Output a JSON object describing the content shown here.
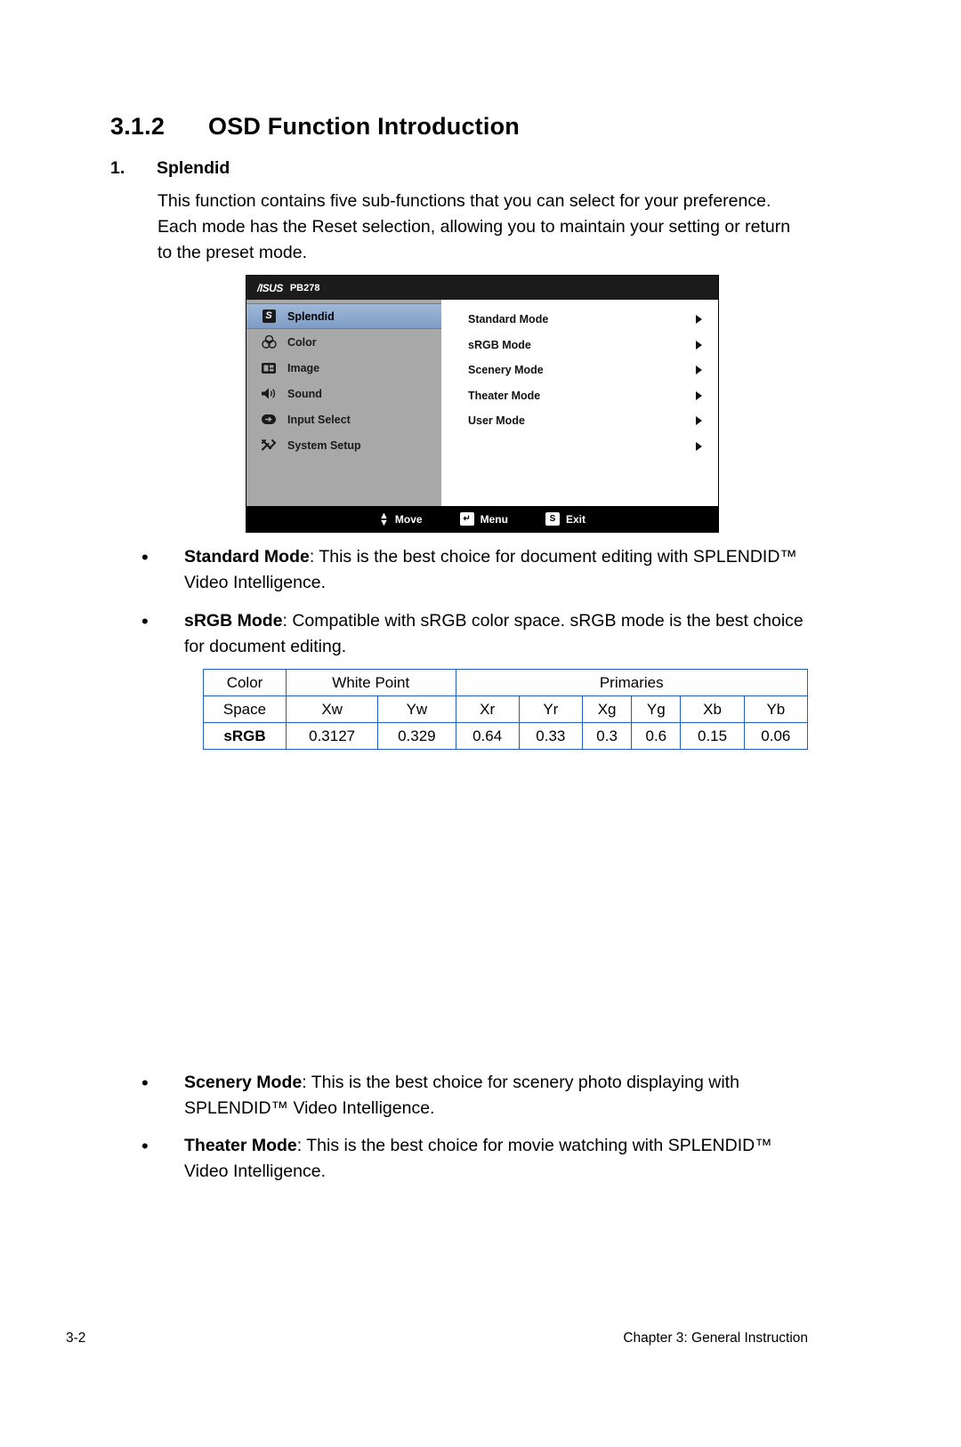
{
  "section": {
    "number": "3.1.2",
    "title": "OSD Function Introduction"
  },
  "subsection": {
    "number": "1.",
    "title": "Splendid",
    "paragraph": "This function contains five sub-functions that you can select for your preference. Each mode has the Reset selection, allowing you to maintain your setting or return to the preset mode."
  },
  "osd": {
    "brand": "/ISUS",
    "model": "PB278",
    "menu": [
      {
        "label": "Splendid",
        "icon": "splendid-icon",
        "active": true
      },
      {
        "label": "Color",
        "icon": "color-icon",
        "active": false
      },
      {
        "label": "Image",
        "icon": "image-icon",
        "active": false
      },
      {
        "label": "Sound",
        "icon": "sound-icon",
        "active": false
      },
      {
        "label": "Input Select",
        "icon": "input-select-icon",
        "active": false
      },
      {
        "label": "System Setup",
        "icon": "system-setup-icon",
        "active": false
      }
    ],
    "options": [
      "Standard Mode",
      "sRGB Mode",
      "Scenery Mode",
      "Theater Mode",
      "User Mode"
    ],
    "footer": {
      "move": "Move",
      "menu": "Menu",
      "exit": "Exit",
      "exit_icon_letter": "S"
    }
  },
  "bullets": {
    "standard": {
      "term": "Standard Mode",
      "text": ": This is the best choice for document editing with SPLENDID™ Video Intelligence."
    },
    "srgb": {
      "term": "sRGB Mode",
      "text": ": Compatible with sRGB color space. sRGB mode is the best choice for document editing."
    },
    "scenery": {
      "term": "Scenery Mode",
      "text": ": This is the best choice for scenery photo displaying with SPLENDID™ Video Intelligence."
    },
    "theater": {
      "term": "Theater Mode",
      "text": ": This is the best choice for movie watching with SPLENDID™ Video Intelligence."
    }
  },
  "srgb_table": {
    "header1": [
      "Color",
      "White Point",
      "Primaries"
    ],
    "header2": [
      "Space",
      "Xw",
      "Yw",
      "Xr",
      "Yr",
      "Xg",
      "Yg",
      "Xb",
      "Yb"
    ],
    "row": [
      "sRGB",
      "0.3127",
      "0.329",
      "0.64",
      "0.33",
      "0.3",
      "0.6",
      "0.15",
      "0.06"
    ]
  },
  "page_footer": {
    "page_number": "3-2",
    "chapter": "Chapter 3: General Instruction"
  },
  "colors": {
    "table_border": "#1f5fbf",
    "osd_menu_bg": "#a8a8a8",
    "osd_highlight": "#8fabcf"
  }
}
